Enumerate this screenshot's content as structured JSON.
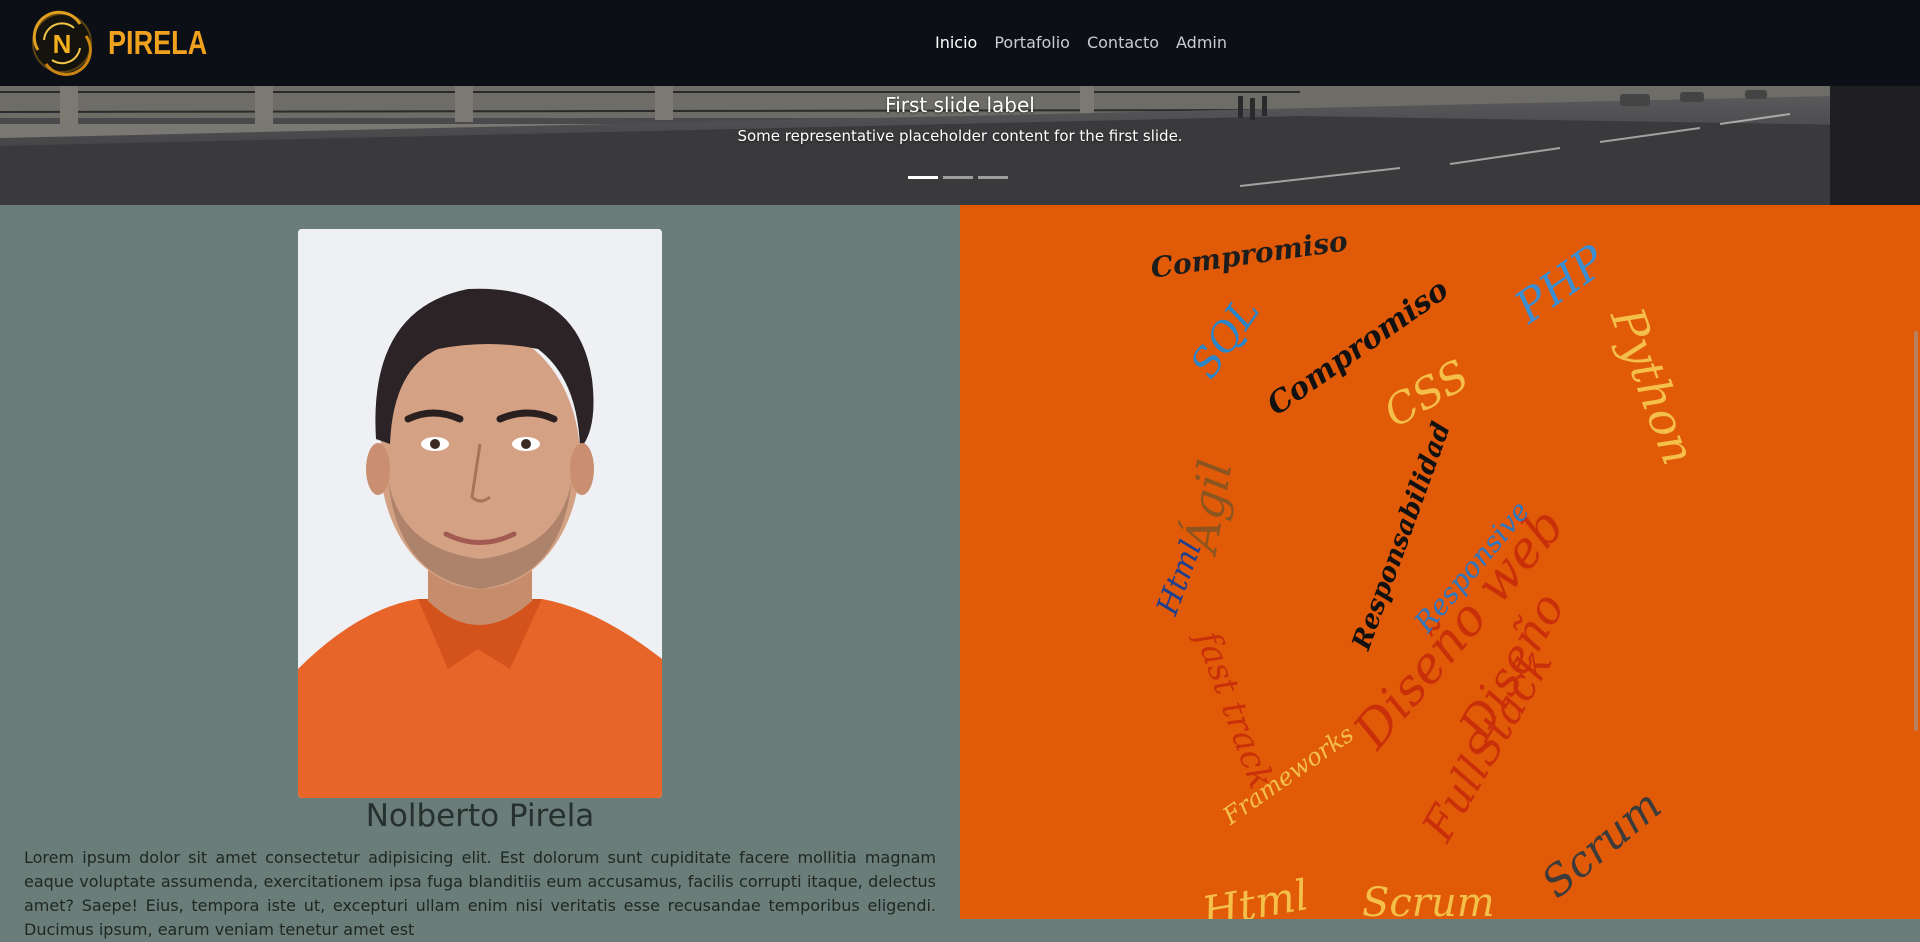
{
  "navbar": {
    "brand": "PIRELA",
    "links": [
      {
        "label": "Inicio",
        "active": true
      },
      {
        "label": "Portafolio",
        "active": false
      },
      {
        "label": "Contacto",
        "active": false
      },
      {
        "label": "Admin",
        "active": false
      }
    ]
  },
  "carousel": {
    "title": "First slide label",
    "text": "Some representative placeholder content for the first slide.",
    "indicators": 3,
    "active_index": 0
  },
  "profile": {
    "name": "Nolberto Pirela",
    "bio": "Lorem ipsum dolor sit amet consectetur adipisicing elit. Est dolorum sunt cupiditate facere mollitia magnam eaque voluptate assumenda, exercitationem ipsa fuga blanditiis eum accusamus, facilis corrupti itaque, delectus amet? Saepe! Eius, tempora iste ut, excepturi ullam enim nisi veritatis esse recusandae temporibus eligendi. Ducimus ipsum, earum veniam tenetur amet est"
  },
  "wordcloud": {
    "words": [
      "Compromiso",
      "SQL",
      "PHP",
      "CSS",
      "Python",
      "Html",
      "Ágil",
      "Diseño web",
      "FullStack",
      "Scrum",
      "Responsabilidad",
      "Responsive",
      "fast track",
      "Frameworks",
      "Diseño",
      "Compromiso",
      "Html",
      "Scrum"
    ]
  },
  "colors": {
    "navbar_bg": "#0c0f15",
    "brand": "#f0a11e",
    "left_bg": "#6b7d78",
    "right_bg": "#e05a08"
  }
}
